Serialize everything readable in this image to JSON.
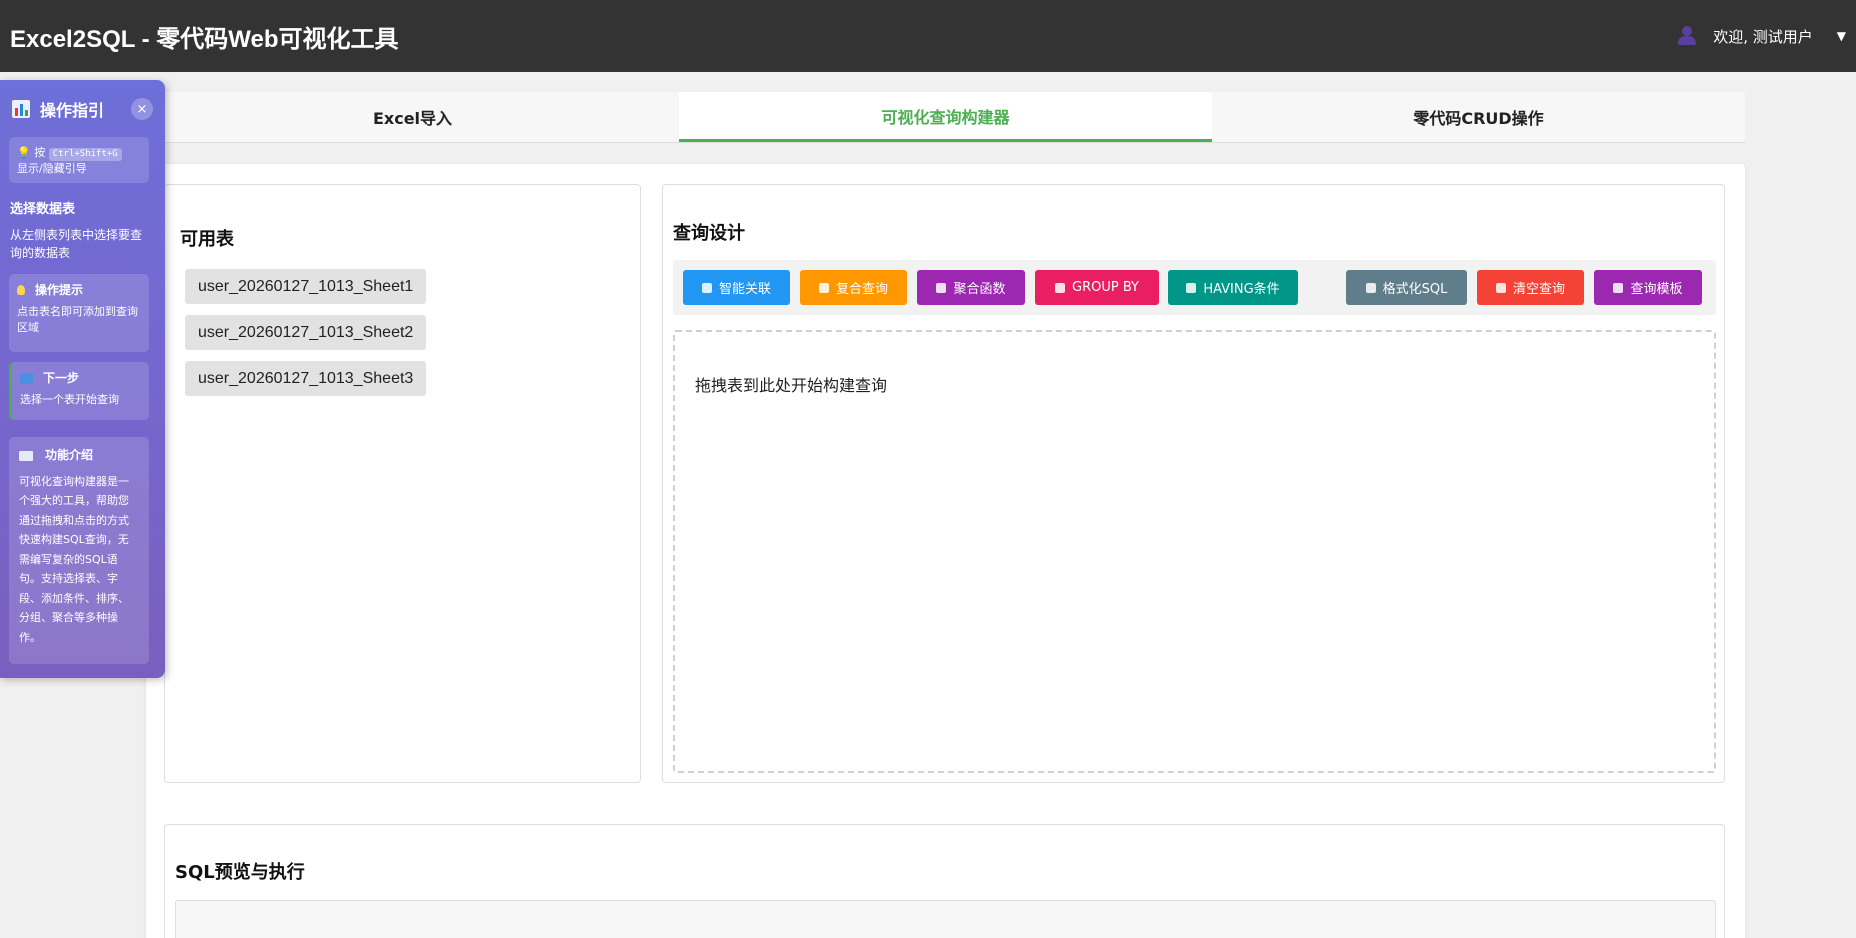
{
  "header": {
    "title": "Excel2SQL - 零代码Web可视化工具",
    "user_greeting": "欢迎, 测试用户",
    "user_menu_caret": "▼"
  },
  "tabs": [
    {
      "label": "Excel导入",
      "active": false
    },
    {
      "label": "可视化查询构建器",
      "active": true
    },
    {
      "label": "零代码CRUD操作",
      "active": false
    }
  ],
  "tables_panel": {
    "title": "可用表",
    "tables": [
      "user_20260127_1013_Sheet1",
      "user_20260127_1013_Sheet2",
      "user_20260127_1013_Sheet3"
    ]
  },
  "design_panel": {
    "title": "查询设计",
    "buttons": [
      {
        "label": "智能关联",
        "color": "#2196f3",
        "icon": "lightbulb-icon"
      },
      {
        "label": "复合查询",
        "color": "#ff9800",
        "icon": "link-icon"
      },
      {
        "label": "聚合函数",
        "color": "#9c27b0",
        "icon": "bar-chart-icon"
      },
      {
        "label": "GROUP BY",
        "color": "#e91e63",
        "icon": "clipboard-icon"
      },
      {
        "label": "HAVING条件",
        "color": "#009688",
        "icon": "magnifier-icon"
      },
      {
        "label": "格式化SQL",
        "color": "#607d8b",
        "icon": "document-icon"
      },
      {
        "label": "清空查询",
        "color": "#f44336",
        "icon": "trash-icon"
      },
      {
        "label": "查询模板",
        "color": "#9c27b0",
        "icon": "template-icon"
      }
    ],
    "drop_hint": "拖拽表到此处开始构建查询"
  },
  "sql_panel": {
    "title": "SQL预览与执行"
  },
  "guide": {
    "title": "操作指引",
    "close_label": "×",
    "shortcut_prefix": "💡 按",
    "shortcut_keys": "Ctrl+Shift+G",
    "shortcut_suffix": "显示/隐藏引导",
    "step_title": "选择数据表",
    "step_text": "从左侧表列表中选择要查询的数据表",
    "tip_title": "操作提示",
    "tip_text": "点击表名即可添加到查询区域",
    "next_title": "下一步",
    "next_text": "选择一个表开始查询",
    "feature_title": "功能介绍",
    "feature_text": "可视化查询构建器是一个强大的工具，帮助您通过拖拽和点击的方式快速构建SQL查询，无需编写复杂的SQL语句。支持选择表、字段、添加条件、排序、分组、聚合等多种操作。",
    "accent_color": "#6e6fd8"
  }
}
